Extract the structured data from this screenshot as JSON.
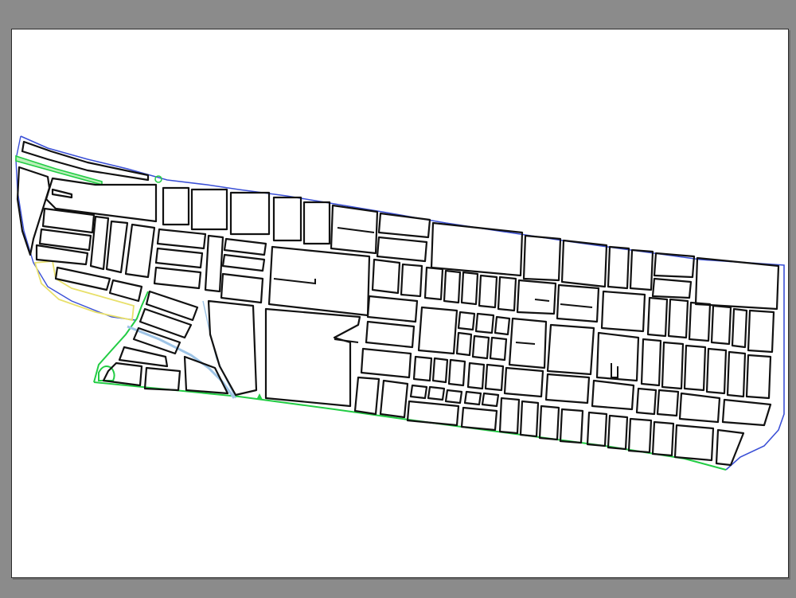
{
  "drawing": {
    "background_color": "#8b8b8b",
    "sheet_color": "#ffffff",
    "boundary_north_color": "#3a4fd6",
    "boundary_south_color": "#22cc44",
    "block_outline_color": "#111111",
    "green_strip_color": "#22cc44",
    "yellow_strip_color": "#f2ef8a",
    "canal_color": "#9ec4e6"
  }
}
